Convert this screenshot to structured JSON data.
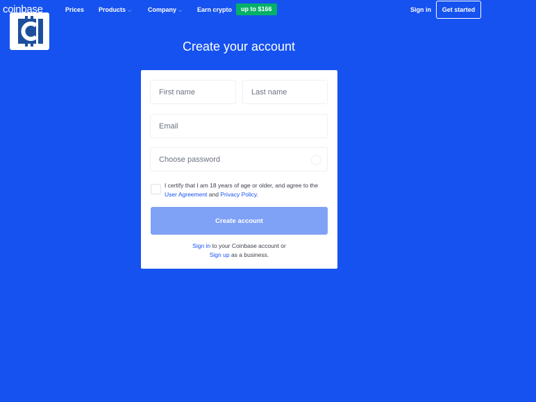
{
  "header": {
    "brand": "coinbase",
    "nav": [
      {
        "label": "Prices",
        "has_dropdown": false
      },
      {
        "label": "Products",
        "has_dropdown": true
      },
      {
        "label": "Company",
        "has_dropdown": true
      },
      {
        "label": "Earn crypto",
        "has_dropdown": false
      }
    ],
    "promo_badge": "up to $166",
    "sign_in": "Sign in",
    "get_started": "Get started",
    "chevron": "⌵"
  },
  "colors": {
    "background": "#1652f0",
    "promo": "#05b169",
    "button_disabled": "#7fa2f6"
  },
  "form": {
    "title": "Create your account",
    "first_name_placeholder": "First name",
    "last_name_placeholder": "Last name",
    "email_placeholder": "Email",
    "password_placeholder": "Choose password",
    "terms_text": "I certify that I am 18 years of age or older, and agree to the",
    "user_agreement": "User Agreement",
    "and": "and",
    "privacy_policy": "Privacy Policy",
    "period": ".",
    "submit": "Create account",
    "footer_sign_in": "Sign in",
    "footer_text_1": "to your Coinbase account or",
    "footer_sign_up": "Sign up",
    "footer_text_2": "as a business."
  }
}
